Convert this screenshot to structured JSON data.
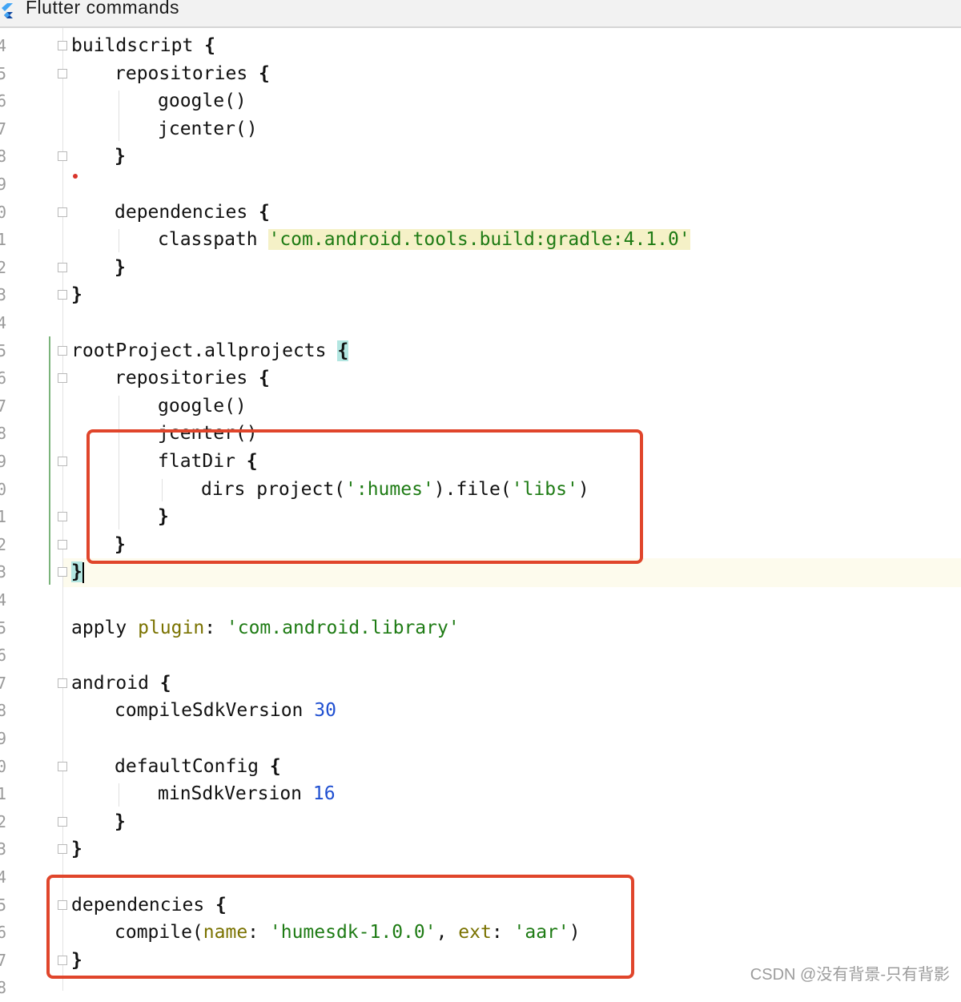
{
  "window": {
    "title": "Flutter commands",
    "icon": "flutter-icon"
  },
  "gutter": {
    "line_numbers": [
      "4",
      "5",
      "6",
      "7",
      "8",
      "9",
      "0",
      "1",
      "2",
      "3",
      "4",
      "5",
      "6",
      "7",
      "8",
      "9",
      "0",
      "1",
      "2",
      "3",
      "4",
      "5",
      "6",
      "7",
      "8",
      "9",
      "0",
      "1",
      "2",
      "3",
      "4",
      "5",
      "6",
      "7",
      "8"
    ]
  },
  "editor": {
    "lines": [
      {
        "indent": 0,
        "segs": [
          {
            "t": "buildscript ",
            "c": "kw"
          },
          {
            "t": "{",
            "c": "brace"
          }
        ]
      },
      {
        "indent": 1,
        "segs": [
          {
            "t": "repositories ",
            "c": "kw"
          },
          {
            "t": "{",
            "c": "brace"
          }
        ]
      },
      {
        "indent": 2,
        "segs": [
          {
            "t": "google()",
            "c": "kw"
          }
        ]
      },
      {
        "indent": 2,
        "segs": [
          {
            "t": "jcenter()",
            "c": "kw"
          }
        ]
      },
      {
        "indent": 1,
        "segs": [
          {
            "t": "}",
            "c": "brace"
          }
        ]
      },
      {
        "indent": 0,
        "segs": []
      },
      {
        "indent": 1,
        "segs": [
          {
            "t": "dependencies ",
            "c": "kw"
          },
          {
            "t": "{",
            "c": "brace"
          }
        ]
      },
      {
        "indent": 2,
        "segs": [
          {
            "t": "classpath ",
            "c": "kw"
          },
          {
            "t": "'com.android.tools.build:gradle:4.1.0'",
            "c": "str hl-str"
          }
        ]
      },
      {
        "indent": 1,
        "segs": [
          {
            "t": "}",
            "c": "brace"
          }
        ]
      },
      {
        "indent": 0,
        "segs": [
          {
            "t": "}",
            "c": "brace"
          }
        ]
      },
      {
        "indent": 0,
        "segs": []
      },
      {
        "indent": 0,
        "segs": [
          {
            "t": "rootProject.allprojects ",
            "c": "kw"
          },
          {
            "t": "{",
            "c": "brace brace-match"
          }
        ]
      },
      {
        "indent": 1,
        "segs": [
          {
            "t": "repositories ",
            "c": "kw"
          },
          {
            "t": "{",
            "c": "brace"
          }
        ]
      },
      {
        "indent": 2,
        "segs": [
          {
            "t": "google()",
            "c": "kw"
          }
        ]
      },
      {
        "indent": 2,
        "segs": [
          {
            "t": "jcenter()",
            "c": "kw"
          }
        ]
      },
      {
        "indent": 2,
        "segs": [
          {
            "t": "flatDir ",
            "c": "kw"
          },
          {
            "t": "{",
            "c": "brace"
          }
        ]
      },
      {
        "indent": 3,
        "segs": [
          {
            "t": "dirs project(",
            "c": "kw"
          },
          {
            "t": "':humes'",
            "c": "str"
          },
          {
            "t": ").file(",
            "c": "kw"
          },
          {
            "t": "'libs'",
            "c": "str"
          },
          {
            "t": ")",
            "c": "kw"
          }
        ]
      },
      {
        "indent": 2,
        "segs": [
          {
            "t": "}",
            "c": "brace"
          }
        ]
      },
      {
        "indent": 1,
        "segs": [
          {
            "t": "}",
            "c": "brace"
          }
        ]
      },
      {
        "indent": 0,
        "segs": [
          {
            "t": "}",
            "c": "brace brace-match"
          }
        ],
        "cursor": true
      },
      {
        "indent": 0,
        "segs": []
      },
      {
        "indent": 0,
        "segs": [
          {
            "t": "apply ",
            "c": "kw"
          },
          {
            "t": "plugin",
            "c": "param"
          },
          {
            "t": ": ",
            "c": "kw"
          },
          {
            "t": "'com.android.library'",
            "c": "str"
          }
        ]
      },
      {
        "indent": 0,
        "segs": []
      },
      {
        "indent": 0,
        "segs": [
          {
            "t": "android ",
            "c": "kw"
          },
          {
            "t": "{",
            "c": "brace"
          }
        ]
      },
      {
        "indent": 1,
        "segs": [
          {
            "t": "compileSdkVersion ",
            "c": "kw"
          },
          {
            "t": "30",
            "c": "num"
          }
        ]
      },
      {
        "indent": 0,
        "segs": []
      },
      {
        "indent": 1,
        "segs": [
          {
            "t": "defaultConfig ",
            "c": "kw"
          },
          {
            "t": "{",
            "c": "brace"
          }
        ]
      },
      {
        "indent": 2,
        "segs": [
          {
            "t": "minSdkVersion ",
            "c": "kw"
          },
          {
            "t": "16",
            "c": "num"
          }
        ]
      },
      {
        "indent": 1,
        "segs": [
          {
            "t": "}",
            "c": "brace"
          }
        ]
      },
      {
        "indent": 0,
        "segs": [
          {
            "t": "}",
            "c": "brace"
          }
        ]
      },
      {
        "indent": 0,
        "segs": []
      },
      {
        "indent": 0,
        "segs": [
          {
            "t": "dependencies ",
            "c": "kw"
          },
          {
            "t": "{",
            "c": "brace"
          }
        ]
      },
      {
        "indent": 1,
        "segs": [
          {
            "t": "compile(",
            "c": "kw"
          },
          {
            "t": "name",
            "c": "param"
          },
          {
            "t": ": ",
            "c": "kw"
          },
          {
            "t": "'humesdk-1.0.0'",
            "c": "str"
          },
          {
            "t": ", ",
            "c": "kw"
          },
          {
            "t": "ext",
            "c": "param"
          },
          {
            "t": ": ",
            "c": "kw"
          },
          {
            "t": "'aar'",
            "c": "str"
          },
          {
            "t": ")",
            "c": "kw"
          }
        ]
      },
      {
        "indent": 0,
        "segs": [
          {
            "t": "}",
            "c": "brace"
          }
        ]
      }
    ]
  },
  "annotations": {
    "box_color": "#e0452b"
  },
  "watermark": "CSDN @没有背景-只有背影"
}
